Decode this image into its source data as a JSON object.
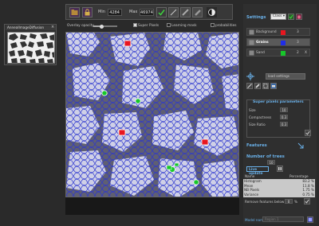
{
  "toolbar": {
    "min_label": "Min",
    "min_value": "4284",
    "max_label": "Max",
    "max_value": "46974"
  },
  "thumbnail": {
    "title": "AnnealImageDiffusion"
  },
  "options": {
    "opacity_label": "Overlay opacity",
    "opacity": 0.35,
    "superpixels_label": "Super Pixels",
    "superpixels_checked": true,
    "learning_mask_label": "Learning mask",
    "learning_mask_checked": false,
    "probabilities_label": "probabilities",
    "probabilities_checked": false
  },
  "settings": {
    "title": "Settings",
    "dropdown_value": "Class",
    "classes": [
      {
        "name": "Background",
        "color": "#e8161f",
        "count": "3",
        "selected": false
      },
      {
        "name": "Grains",
        "color": "#1f2de8",
        "count": "3",
        "selected": true
      },
      {
        "name": "Sand",
        "color": "#17c72a",
        "count": "2",
        "close": "X",
        "selected": false
      }
    ],
    "load_settings_label": "load settings"
  },
  "superpixel_params": {
    "title": "Super pixels parameters",
    "size_label": "Size",
    "size_value": "10",
    "compactness_label": "Compactness",
    "compactness_value": "0.3",
    "size_ratio_label": "Size Ratio",
    "size_ratio_value": "0.3"
  },
  "features": {
    "title": "Features",
    "trees_title": "Number of trees",
    "trees_value": "10",
    "live_update_label": "Live update",
    "table_header_name": "Name",
    "table_header_pct": "Percentage",
    "rows": [
      {
        "name": "Histogram",
        "pct": "83.2 %"
      },
      {
        "name": "Mean",
        "pct": "11.8 %"
      },
      {
        "name": "NB Pixels",
        "pct": "1.75 %"
      },
      {
        "name": "Variance",
        "pct": "0.75 %"
      }
    ],
    "remove_label": "Remove features below",
    "remove_value": "0",
    "remove_unit": "%"
  },
  "model": {
    "label": "Model name",
    "placeholder": "Region 1"
  },
  "colors": {
    "accent": "#6ab0e8",
    "panel": "#2f2f2f",
    "background_class": "#e8161f",
    "grains_class": "#1f2de8",
    "sand_class": "#17c72a"
  }
}
